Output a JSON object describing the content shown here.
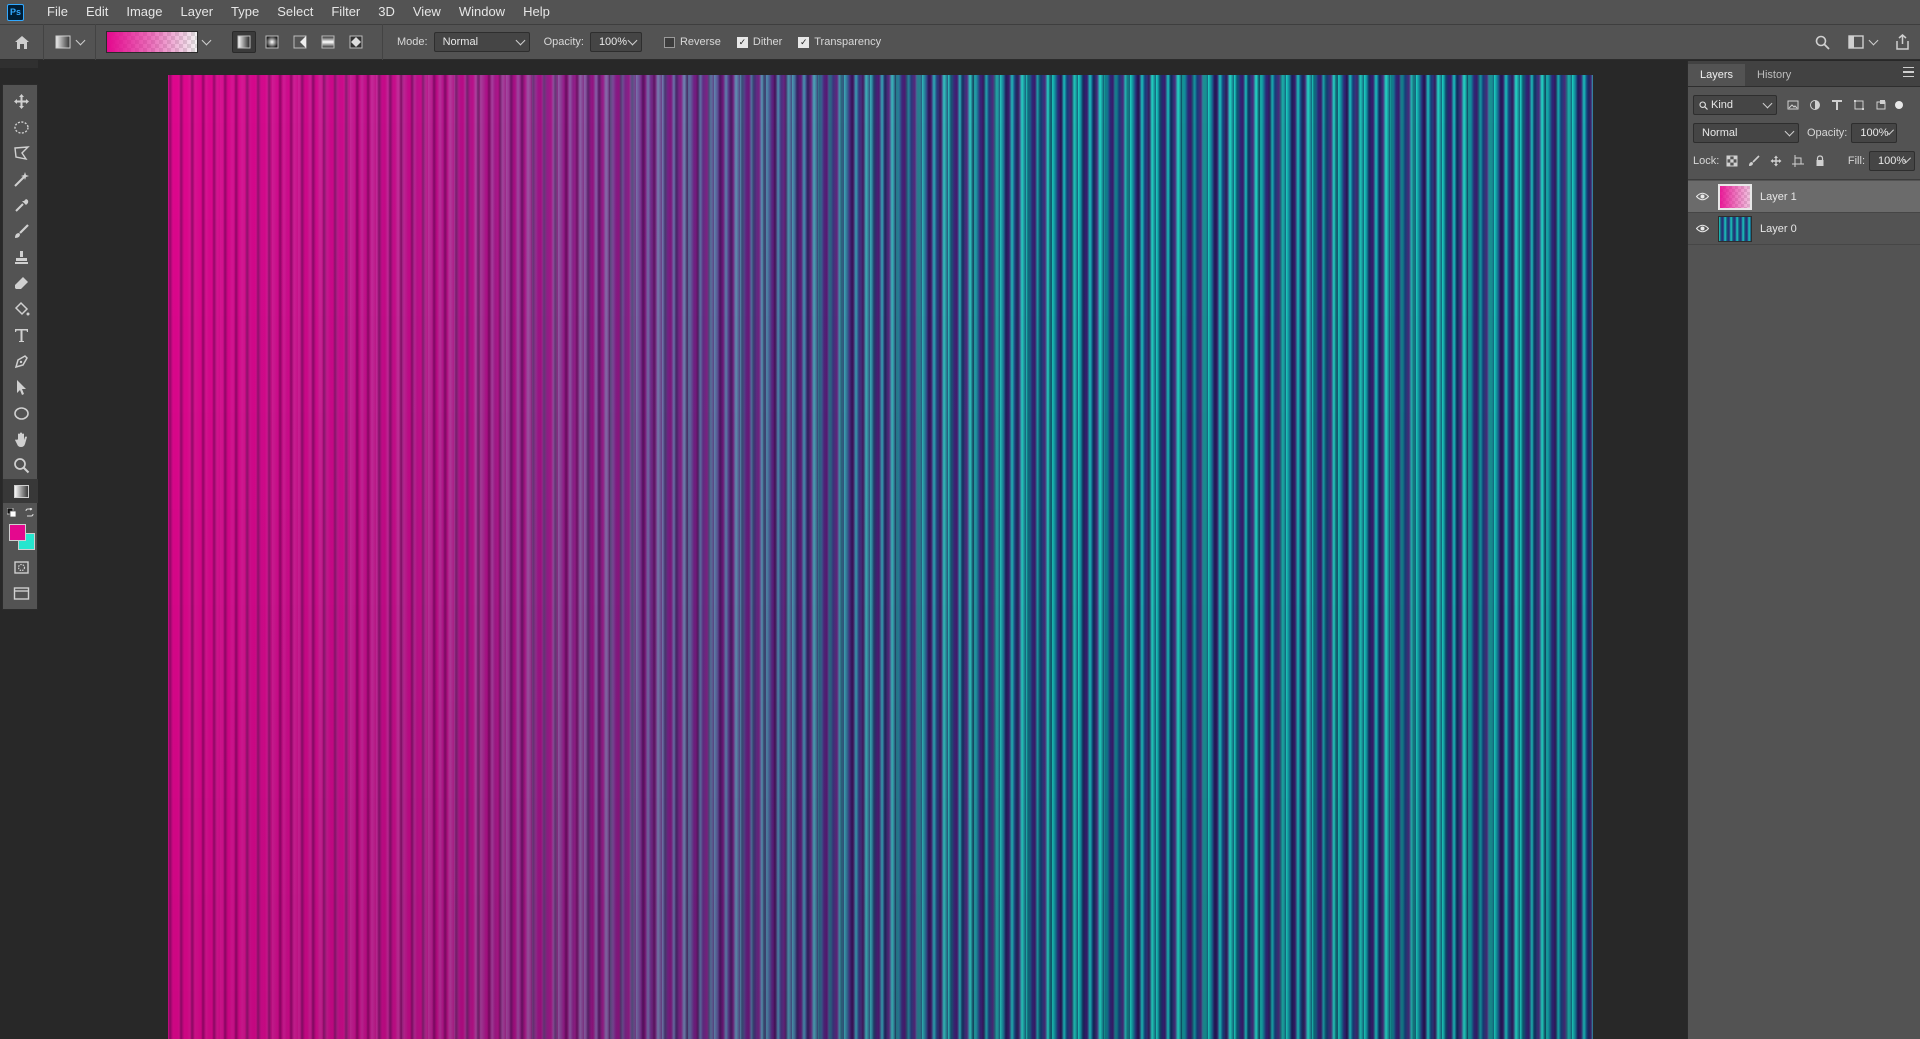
{
  "app": {
    "logo": "Ps"
  },
  "menu": [
    "File",
    "Edit",
    "Image",
    "Layer",
    "Type",
    "Select",
    "Filter",
    "3D",
    "View",
    "Window",
    "Help"
  ],
  "options": {
    "mode_label": "Mode:",
    "mode_value": "Normal",
    "opacity_label": "Opacity:",
    "opacity_value": "100%",
    "reverse_label": "Reverse",
    "reverse_checked": false,
    "dither_label": "Dither",
    "dither_checked": true,
    "transparency_label": "Transparency",
    "transparency_checked": true,
    "gradient_colors": [
      "#e4088e",
      "transparent"
    ],
    "selected_gradient_type": "linear"
  },
  "toolbar": {
    "tools": [
      "move-icon",
      "elliptical-marquee-icon",
      "polygonal-lasso-icon",
      "magic-wand-icon",
      "eyedropper-icon",
      "brush-icon",
      "clone-stamp-icon",
      "eraser-icon",
      "paint-bucket-icon",
      "type-icon",
      "pen-icon",
      "path-selection-icon",
      "ellipse-icon",
      "hand-icon",
      "zoom-icon",
      "gradient-icon"
    ],
    "active_tool": "gradient-icon",
    "foreground_color": "#e4088e",
    "background_color": "#26e6cf"
  },
  "panel": {
    "tabs": [
      "Layers",
      "History"
    ],
    "active_tab": "Layers",
    "kind_label": "Kind",
    "blend_mode": "Normal",
    "opacity_label": "Opacity:",
    "opacity_value": "100%",
    "lock_label": "Lock:",
    "fill_label": "Fill:",
    "fill_value": "100%",
    "layers": [
      {
        "name": "Layer 1",
        "visible": true,
        "selected": true
      },
      {
        "name": "Layer 0",
        "visible": true,
        "selected": false
      }
    ]
  },
  "colors": {
    "chrome": "#535353",
    "canvas_bg": "#282828",
    "magenta": "#e4088e",
    "cyan": "#26e6cf"
  }
}
